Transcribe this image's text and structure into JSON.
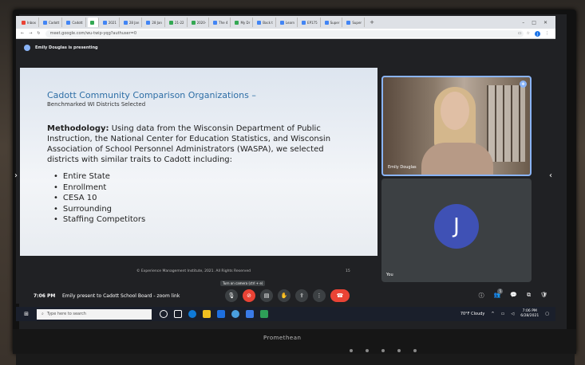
{
  "browser": {
    "tabs": [
      {
        "label": "Inbox",
        "color": "#ea4335"
      },
      {
        "label": "Cadott",
        "color": "#4285f4"
      },
      {
        "label": "Cadott",
        "color": "#4285f4"
      },
      {
        "label": "",
        "color": "#34a853"
      },
      {
        "label": "2021",
        "color": "#4285f4"
      },
      {
        "label": "28 Jan",
        "color": "#4285f4"
      },
      {
        "label": "28 Jan",
        "color": "#4285f4"
      },
      {
        "label": "21-22",
        "color": "#34a853"
      },
      {
        "label": "2020-",
        "color": "#34a853"
      },
      {
        "label": "The 4",
        "color": "#4285f4"
      },
      {
        "label": "My Dr",
        "color": "#34a853"
      },
      {
        "label": "Back t",
        "color": "#4285f4"
      },
      {
        "label": "Learn",
        "color": "#4285f4"
      },
      {
        "label": "EP175",
        "color": "#4285f4"
      },
      {
        "label": "Super",
        "color": "#4285f4"
      },
      {
        "label": "Super",
        "color": "#4285f4"
      }
    ],
    "url": "meet.google.com/wu-twip-yqg?authuser=0",
    "avatar_letter": "J"
  },
  "meet": {
    "presenting_text": "Emily Douglas is presenting",
    "slide": {
      "title": "Cadott Community Comparison Organizations –",
      "subtitle": "Benchmarked WI Districts Selected",
      "methodology_label": "Methodology:",
      "methodology_text": "Using data from the Wisconsin Department of Public Instruction, the National Center for Education Statistics, and Wisconsin Association of School Personnel Administrators (WASPA), we selected districts with similar traits to Cadott including:",
      "bullets": [
        "Entire State",
        "Enrollment",
        "CESA 10",
        "Surrounding",
        "Staffing Competitors"
      ],
      "copyright": "© Experience Management Institute, 2021. All Rights Reserved",
      "page_number": "15"
    },
    "participants": [
      {
        "name": "Emily Douglas"
      },
      {
        "name": "You",
        "avatar_letter": "J",
        "avatar_color": "#3f51b5"
      }
    ],
    "tooltip": "Turn on camera (ctrl + e)",
    "time": "7:06 PM",
    "meeting_title": "Emily present to Cadott School Board - zoom link",
    "people_count": "5"
  },
  "taskbar": {
    "search_placeholder": "Type here to search",
    "weather": "70°F  Cloudy",
    "clock_time": "7:06 PM",
    "clock_date": "6/28/2021"
  },
  "monitor": {
    "brand": "Promethean"
  }
}
